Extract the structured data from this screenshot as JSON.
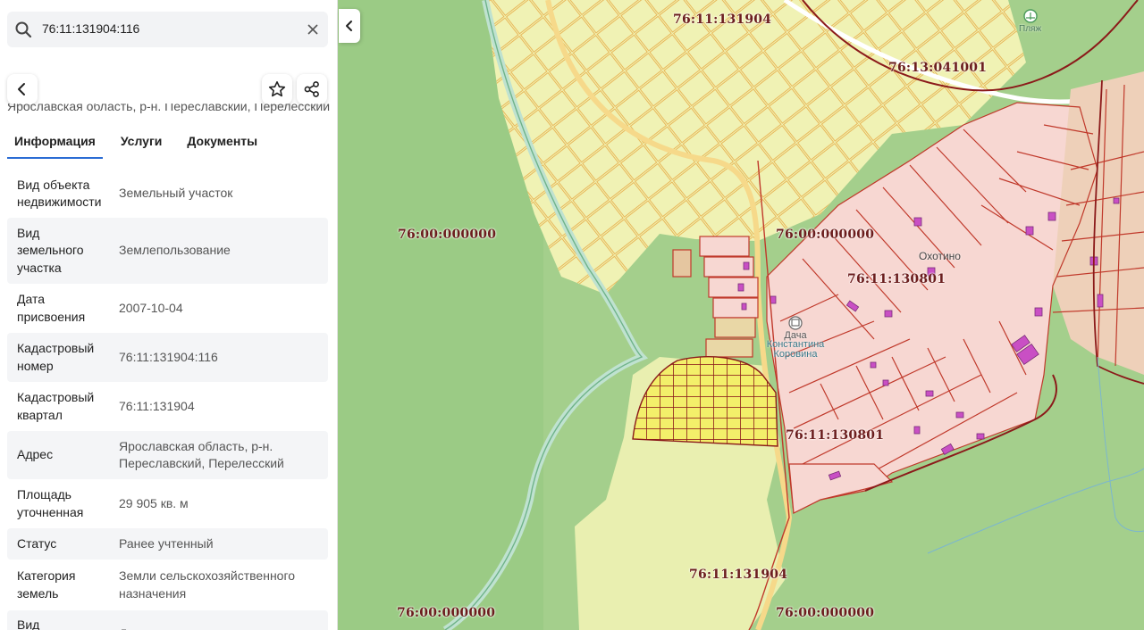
{
  "search": {
    "value": "76:11:131904:116"
  },
  "panel": {
    "address_partial": "Ярославская область, р-н. Переславский, Перелесский",
    "tabs": [
      {
        "label": "Информация",
        "active": true
      },
      {
        "label": "Услуги",
        "active": false
      },
      {
        "label": "Документы",
        "active": false
      }
    ],
    "rows": [
      {
        "label": "Вид объекта недвижимости",
        "value": "Земельный участок"
      },
      {
        "label": "Вид земельного участка",
        "value": "Землепользование"
      },
      {
        "label": "Дата присвоения",
        "value": "2007-10-04"
      },
      {
        "label": "Кадастровый номер",
        "value": "76:11:131904:116"
      },
      {
        "label": "Кадастровый квартал",
        "value": "76:11:131904"
      },
      {
        "label": "Адрес",
        "value": "Ярославская область, р-н. Переславский, Перелесский"
      },
      {
        "label": "Площадь уточненная",
        "value": "29 905 кв. м"
      },
      {
        "label": "Статус",
        "value": "Ранее учтенный"
      },
      {
        "label": "Категория земель",
        "value": "Земли сельскохозяйственного назначения"
      },
      {
        "label": "Вид",
        "value": "Для ведения крестьянского"
      }
    ]
  },
  "map": {
    "cadastral_labels": [
      {
        "id": "q1",
        "text": "76:11:131904"
      },
      {
        "id": "q2",
        "text": "76:13:041001"
      },
      {
        "id": "q3",
        "text": "76:00:000000"
      },
      {
        "id": "q4",
        "text": "76:00:000000"
      },
      {
        "id": "q5",
        "text": "76:11:130801"
      },
      {
        "id": "q6",
        "text": "76:11:130801"
      },
      {
        "id": "q7",
        "text": "76:11:131904"
      },
      {
        "id": "q8",
        "text": "76:00:000000"
      },
      {
        "id": "q9",
        "text": "76:00:000000"
      }
    ],
    "place_labels": {
      "village": "Охотино",
      "museum_line1": "Дача",
      "museum_line2": "Константина",
      "museum_line3": "Коровина",
      "beach": "Пляж"
    },
    "colors": {
      "forest": "#a4cf8c",
      "meadow": "#f0f2b4",
      "parcel_border": "#c0392b",
      "selected_parcel": "#f3ef6a",
      "road": "#f6d98a",
      "building": "#c94fc4"
    }
  }
}
